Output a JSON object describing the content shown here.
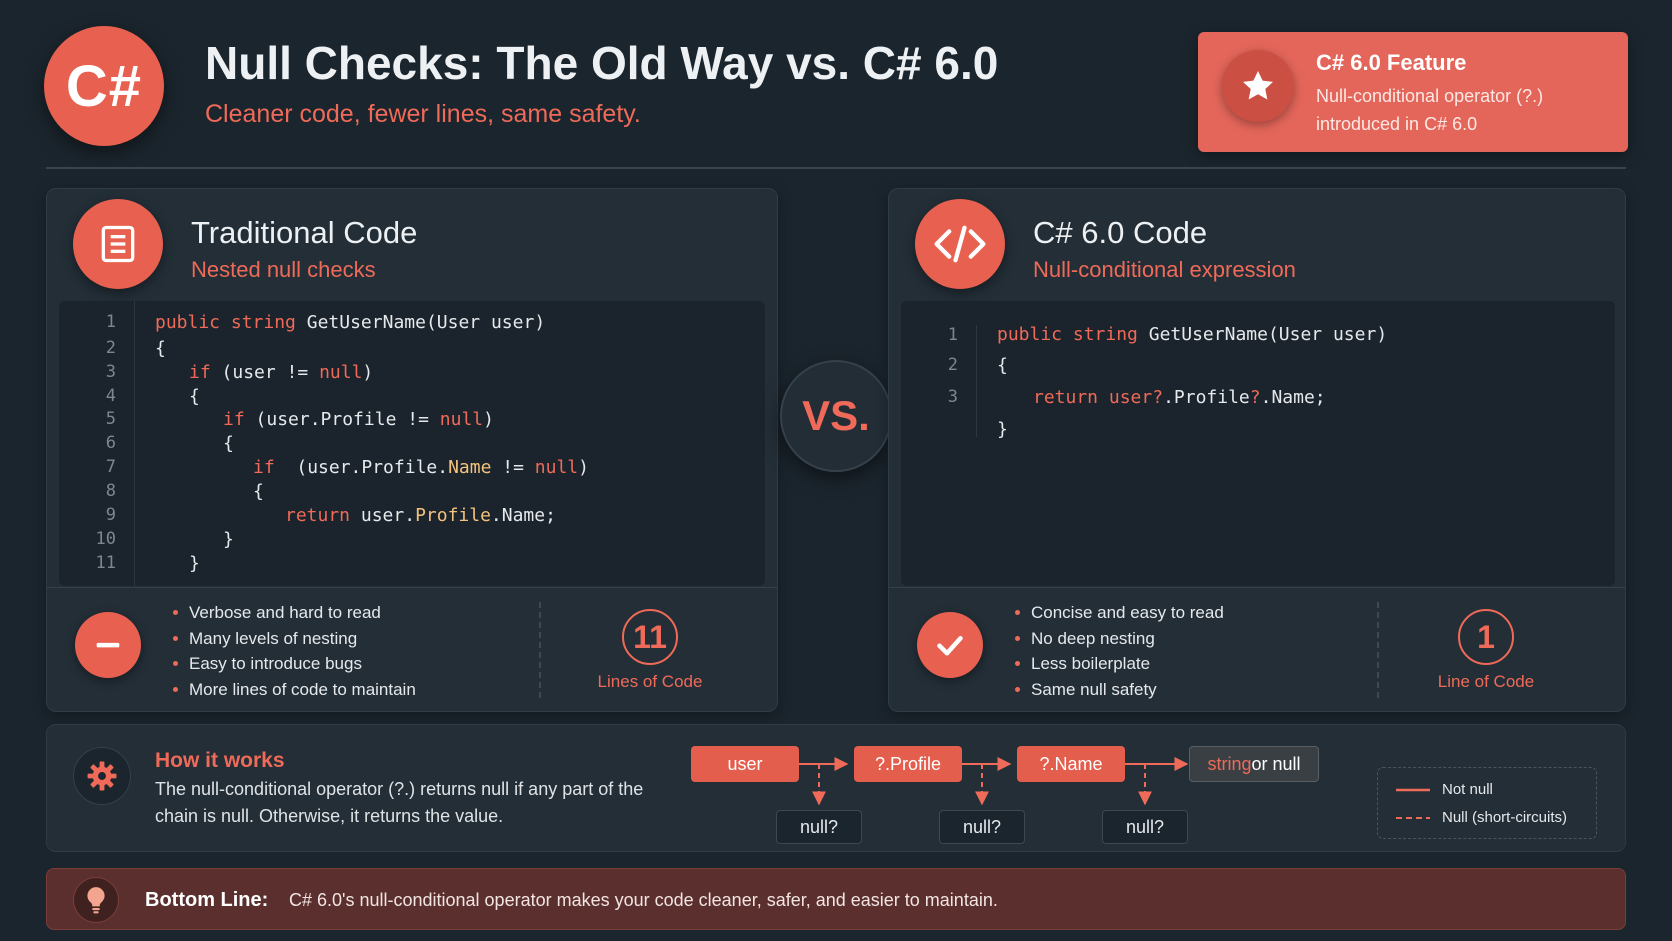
{
  "header": {
    "logo": "C#",
    "title": "Null Checks: The Old Way vs. C# 6.0",
    "subtitle": "Cleaner code, fewer lines, same safety."
  },
  "feature": {
    "icon": "star-icon",
    "title": "C# 6.0 Feature",
    "line1": "Null-conditional operator (?.)",
    "line2": "introduced in C# 6.0"
  },
  "vs_label": "VS.",
  "traditional": {
    "icon": "document-icon",
    "title": "Traditional Code",
    "subtitle": "Nested null checks",
    "line_numbers": [
      "1",
      "2",
      "3",
      "4",
      "5",
      "6",
      "7",
      "8",
      "9",
      "10",
      "11"
    ],
    "bullets": [
      "Verbose and hard to read",
      "Many levels of nesting",
      "Easy to introduce bugs",
      "More lines of code to maintain"
    ],
    "count": "11",
    "count_label": "Lines of Code"
  },
  "modern": {
    "icon": "code-icon",
    "title": "C# 6.0 Code",
    "subtitle": "Null-conditional expression",
    "line_numbers": [
      "1",
      "2",
      "3"
    ],
    "bullets": [
      "Concise and easy to read",
      "No deep nesting",
      "Less boilerplate",
      "Same null safety"
    ],
    "count": "1",
    "count_label": "Line of Code"
  },
  "code": {
    "kw_public": "public",
    "kw_string": "string",
    "sig_rest": " GetUserName(User user)",
    "brace_open": "{",
    "brace_close": "}",
    "kw_if": "if",
    "kw_null": "null",
    "kw_return": "return",
    "t_cond1": " (user != ",
    "t_cond2": " (user.Profile != ",
    "t_cond3a": "  (user.Profile.",
    "t_name": "Name",
    "t_cond3b": " != ",
    "t_close": ")",
    "t_ret_a": " user.",
    "t_profile": "Profile",
    "t_ret_b": ".Name;",
    "m_user": "user?",
    "m_mid": ".Profile",
    "m_q": "?",
    "m_end": ".Name;"
  },
  "how": {
    "title": "How it works",
    "description": "The null-conditional operator (?.) returns null if any part of the chain is null. Otherwise, it returns the value.",
    "chain": [
      "user",
      "?.Profile",
      "?.Name"
    ],
    "result_a": "string",
    "result_b": " or null",
    "null_label": "null?",
    "legend": {
      "solid": "Not null",
      "dashed": "Null (short-circuits)"
    }
  },
  "bottom": {
    "label": "Bottom Line:",
    "text": "C# 6.0's null-conditional operator makes your code cleaner, safer, and easier to maintain."
  },
  "colors": {
    "accent": "#e8604f",
    "background": "#1b252d",
    "panel": "#232e37"
  }
}
